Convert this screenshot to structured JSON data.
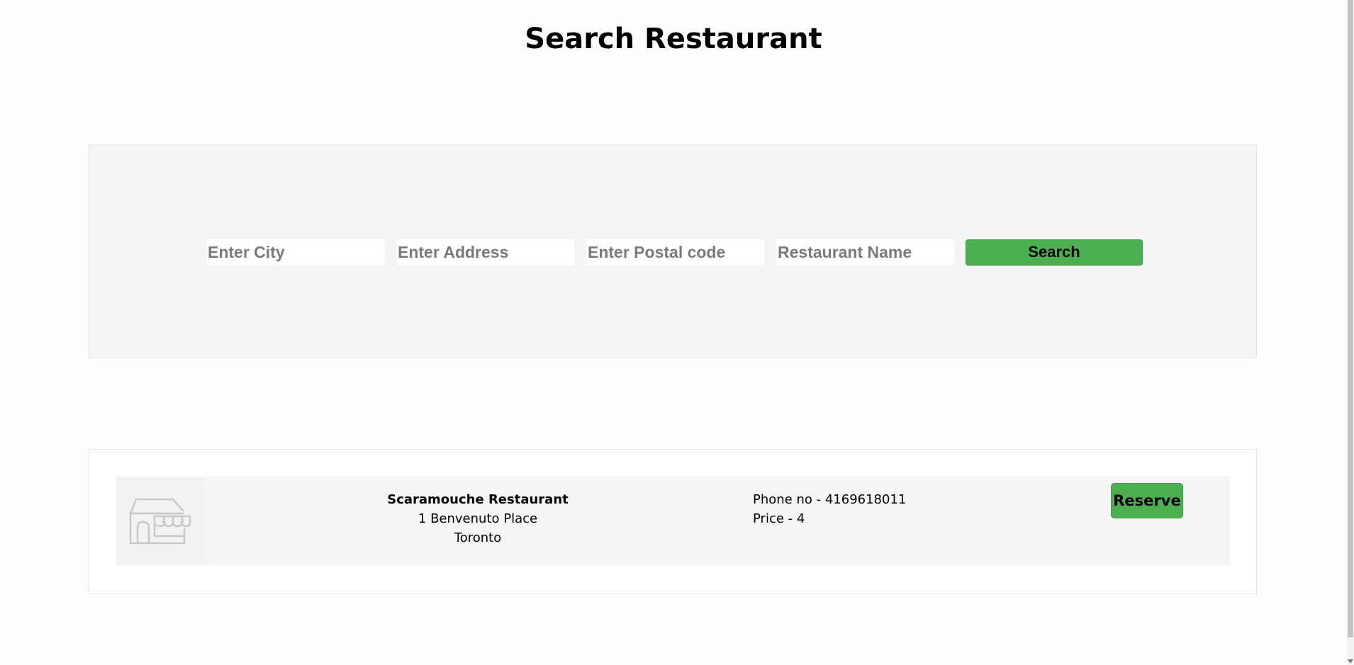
{
  "page": {
    "title": "Search Restaurant"
  },
  "search": {
    "city_placeholder": "Enter City",
    "address_placeholder": "Enter Address",
    "postal_placeholder": "Enter Postal code",
    "name_placeholder": "Restaurant Name",
    "button_label": "Search"
  },
  "results": [
    {
      "icon": "store-icon",
      "name": "Scaramouche Restaurant",
      "address": "1 Benvenuto Place",
      "city": "Toronto",
      "phone": "Phone no - 4169618011",
      "price": "Price - 4",
      "reserve_label": "Reserve"
    }
  ],
  "colors": {
    "accent": "#4caf50",
    "panel_bg": "#f5f5f5"
  }
}
